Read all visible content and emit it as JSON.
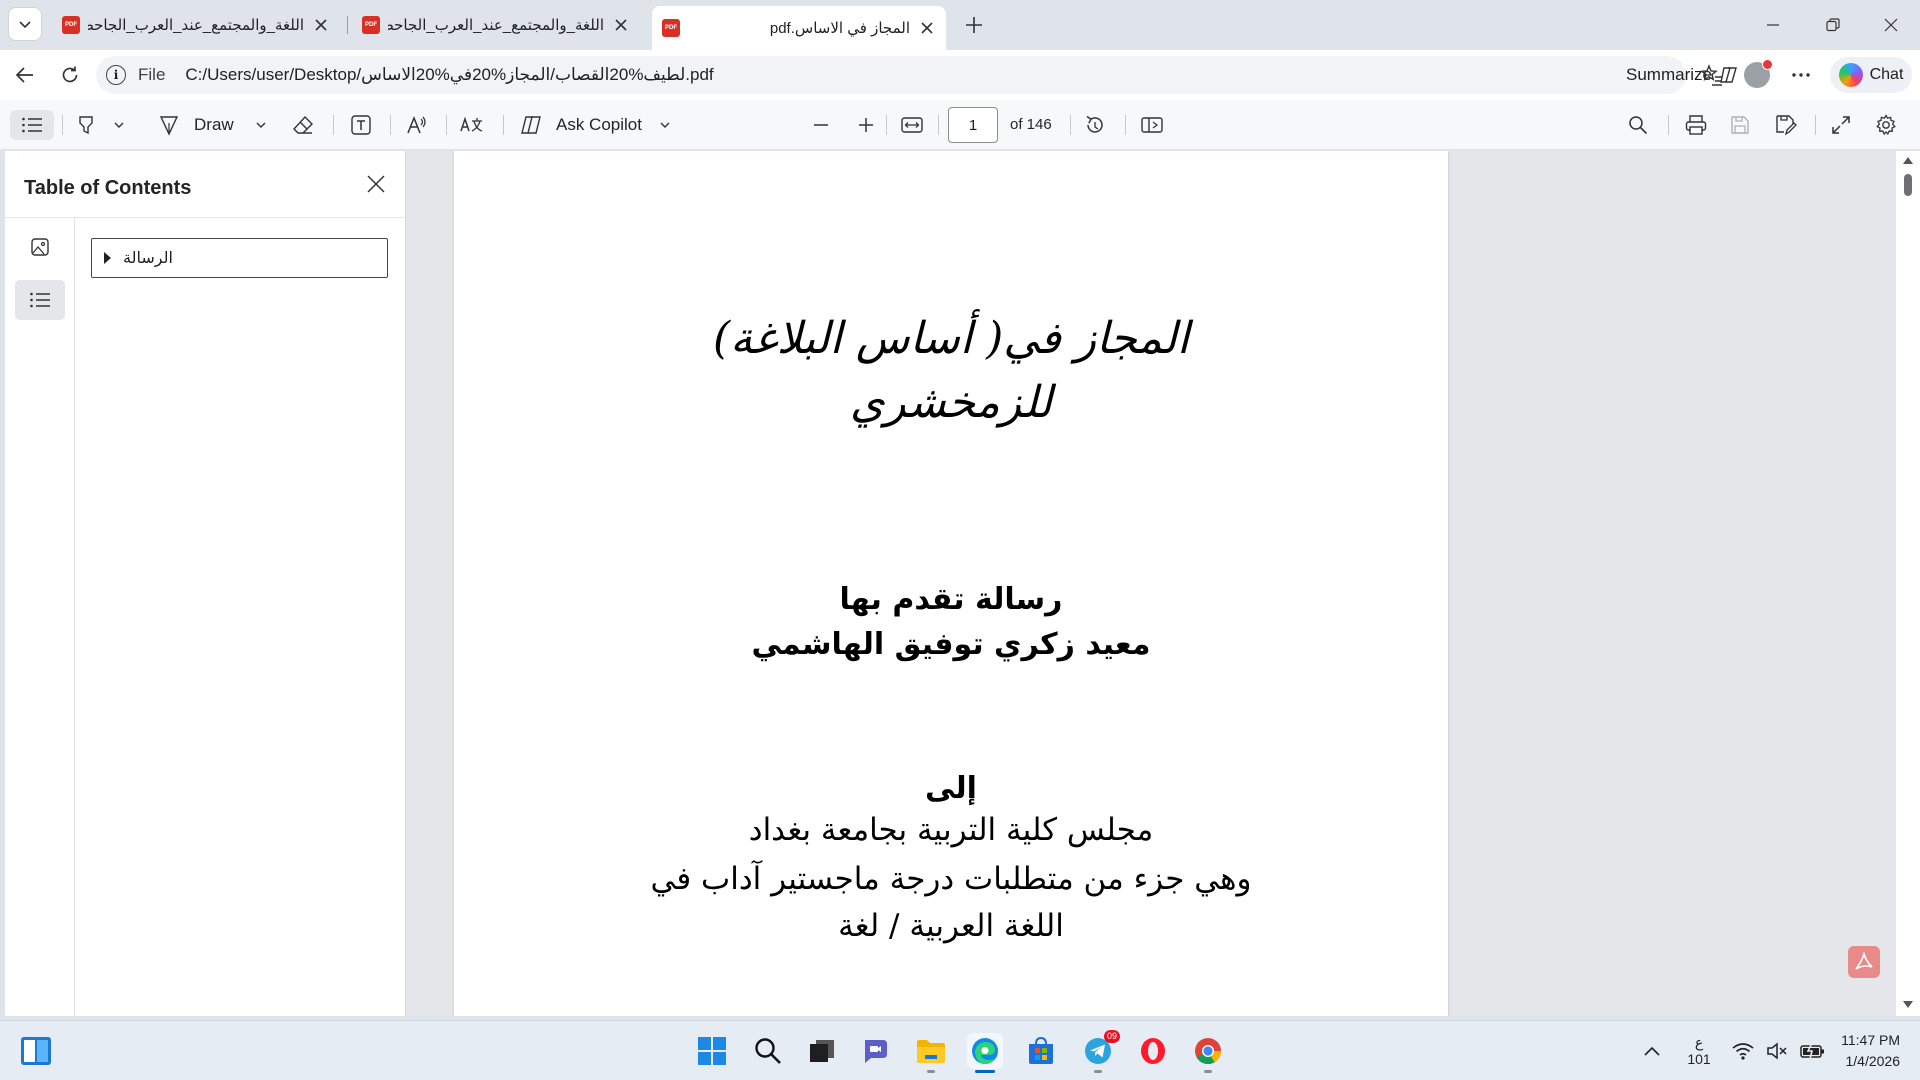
{
  "tabs": [
    {
      "title": "اللغة_والمجتمع_عند_العرب_الجاحظ_نـ",
      "active": false
    },
    {
      "title": "اللغة_والمجتمع_عند_العرب_الجاحظ_نـ",
      "active": false
    },
    {
      "title": "المجاز في الاساس.pdf",
      "active": true
    }
  ],
  "pdf_badge": "PDF",
  "address": {
    "scheme_label": "File",
    "url": "C:/Users/user/Desktop/لطيف%20القصاب/المجاز%20في%20الاساس.pdf",
    "summarize_label": "Summarize",
    "chat_label": "Chat"
  },
  "toolbar": {
    "draw_label": "Draw",
    "ask_copilot_label": "Ask Copilot",
    "page_number": "1",
    "page_count": "of 146"
  },
  "side_panel": {
    "title": "Table of Contents",
    "items": [
      {
        "label": "الرسالة"
      }
    ]
  },
  "document": {
    "title_line1": "المجاز في( أساس البلاغة)",
    "title_line2": "للزمخشري",
    "submitted_by_line1": "رسالة تقدم بها",
    "submitted_by_line2": "معيد زكري توفيق الهاشمي",
    "to_label": "إلى",
    "council": "مجلس كلية التربية بجامعة بغداد",
    "requirement_line1": "وهي جزء من متطلبات درجة ماجستير آداب في",
    "requirement_line2": "اللغة العربية / لغة"
  },
  "taskbar": {
    "telegram_badge": "09",
    "tray_lang_line1": "ع",
    "tray_lang_line2": "101",
    "time": "11:47 PM",
    "date": "1/4/2026"
  },
  "colors": {
    "accent": "#0067c0",
    "pdf_red": "#d93025",
    "tab_strip_bg": "#dfe3ea",
    "doc_bg": "#e4e6ea"
  }
}
